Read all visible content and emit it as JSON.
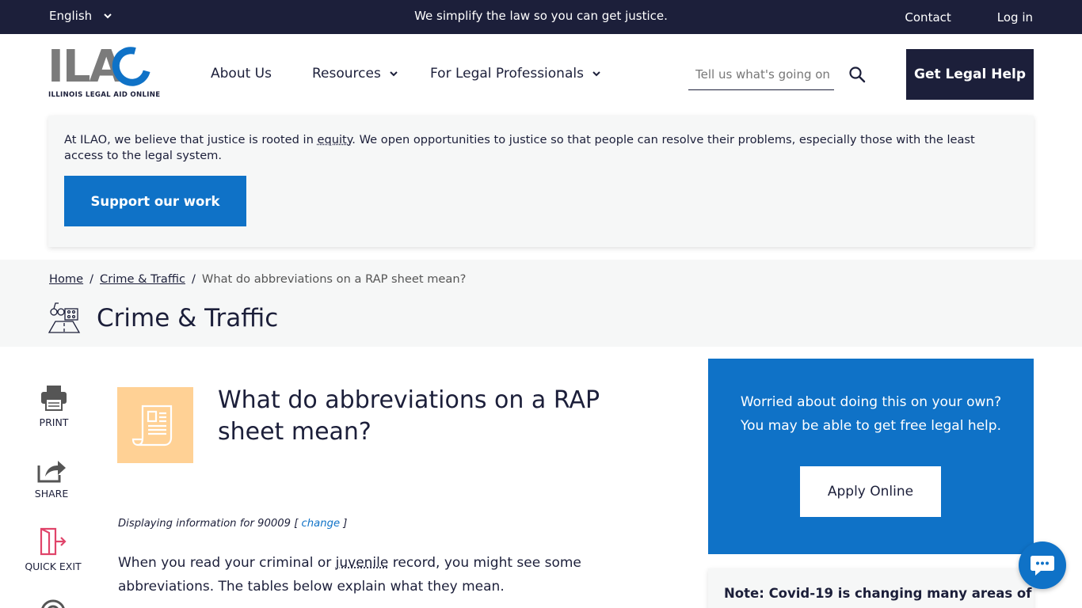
{
  "topbar": {
    "language": "English",
    "tagline": "We simplify the law so you can get justice.",
    "contact": "Contact",
    "login": "Log in"
  },
  "header": {
    "logo_letters": "ILAO",
    "logo_subtitle": "ILLINOIS LEGAL AID ONLINE",
    "nav": {
      "about": "About Us",
      "resources": "Resources",
      "professionals": "For Legal Professionals"
    },
    "search_placeholder": "Tell us what's going on",
    "get_help": "Get Legal Help"
  },
  "equity": {
    "text_before": "At ILAO, we believe that justice is rooted in ",
    "link_word": "equity",
    "text_after": ". We open opportunities to justice so that people can resolve their problems, especially those with the least access to the legal system.",
    "button": "Support our work"
  },
  "breadcrumb": {
    "home": "Home",
    "category": "Crime & Traffic",
    "separator": "/",
    "current": "What do abbreviations on a RAP sheet mean?"
  },
  "category_title": "Crime & Traffic",
  "tools": {
    "print": "PRINT",
    "share": "SHARE",
    "quick_exit": "QUICK EXIT"
  },
  "article": {
    "title": "What do abbreviations on a RAP sheet mean?",
    "zip_prefix": "Displaying information for 90009 [ ",
    "zip_change": "change",
    "zip_suffix": " ]",
    "intro_before": "When you read your criminal or ",
    "intro_link": "juvenile",
    "intro_after": " record, you might see some abbreviations. The tables below explain what they mean."
  },
  "sidebar": {
    "apply_line1": "Worried about doing this on your own?",
    "apply_line2": "You may be able to get free legal help.",
    "apply_button": "Apply Online",
    "covid_note": "Note: Covid-19 is changing many areas of"
  },
  "colors": {
    "navy": "#1c1f3a",
    "blue": "#0f72c7",
    "light_bg": "#f6f7f7",
    "article_icon_bg": "#ffd195",
    "quick_exit": "#e0446a"
  }
}
